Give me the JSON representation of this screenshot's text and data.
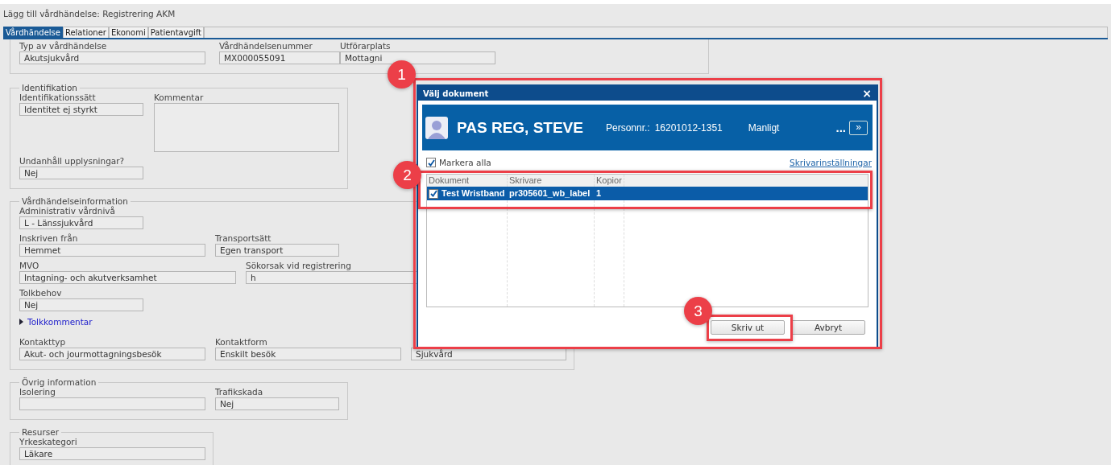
{
  "title": "Lägg till vårdhändelse: Registrering AKM",
  "tabs": [
    {
      "label": "Vårdhändelse",
      "selected": true
    },
    {
      "label": "Relationer",
      "selected": false
    },
    {
      "label": "Ekonomi",
      "selected": false
    },
    {
      "label": "Patientavgift",
      "selected": false
    }
  ],
  "sections": [
    {
      "rows": [
        [
          {
            "label": "Typ av vårdhändelse",
            "value": "Akutsjukvård"
          },
          {
            "label": "Vårdhändelsenummer",
            "value": "MX000055091"
          },
          {
            "label": "Utförarplats",
            "value": "Mottagni"
          }
        ]
      ]
    },
    {
      "legend": "Identifikation",
      "rows": [
        [
          {
            "label": "Identifikationssätt",
            "value": "Identitet ej styrkt"
          },
          {
            "label": "Kommentar",
            "kind": "textarea"
          }
        ],
        [
          {
            "label": "Undanhåll upplysningar?",
            "value": "Nej"
          }
        ]
      ]
    },
    {
      "legend": "Vårdhändelseinformation",
      "rows": [
        [
          {
            "label": "Administrativ vårdnivå",
            "value": "L - Länssjukvård"
          }
        ],
        [
          {
            "label": "Inskriven från",
            "value": "Hemmet"
          },
          {
            "label": "Transportsätt",
            "value": "Egen transport"
          }
        ],
        [
          {
            "label": "MVO",
            "value": "Intagning- och akutverksamhet"
          },
          {
            "label": "Sökorsak vid registrering",
            "value": "h"
          }
        ],
        [
          {
            "label": "Tolkbehov",
            "value": "Nej"
          }
        ],
        [
          {
            "kind": "link",
            "label": "Tolkkommentar"
          }
        ],
        [
          {
            "label": "Kontakttyp",
            "value": "Akut- och jourmottagningsbesök"
          },
          {
            "label": "Kontaktform",
            "value": "Enskilt besök"
          },
          {
            "value": "Sjukvård"
          }
        ]
      ]
    },
    {
      "legend": "Övrig information",
      "rows": [
        [
          {
            "label": "Isolering"
          },
          {
            "label": "Trafikskada",
            "value": "Nej"
          }
        ]
      ]
    },
    {
      "legend": "Resurser",
      "rows": [
        [
          {
            "label": "Yrkeskategori",
            "value": "Läkare"
          }
        ]
      ]
    }
  ],
  "dialog": {
    "title": "Välj dokument",
    "close": "×",
    "patient": {
      "name": "PAS REG, STEVE",
      "personnr_label": "Personnr.:",
      "personnr": "16201012-1351",
      "gender": "Manligt",
      "more": "...",
      "expand": "»"
    },
    "select_all": {
      "label": "Markera alla",
      "checked": true
    },
    "printer_settings": "Skrivarinställningar",
    "columns": [
      "Dokument",
      "Skrivare",
      "Kopior"
    ],
    "rows": [
      {
        "checked": true,
        "selected": true,
        "document": "Test Wristband",
        "printer": "pr305601_wb_label",
        "copies": "1"
      }
    ],
    "buttons": [
      "Skriv ut",
      "Avbryt"
    ]
  },
  "annotations": [
    {
      "number": "1"
    },
    {
      "number": "2"
    },
    {
      "number": "3"
    }
  ]
}
